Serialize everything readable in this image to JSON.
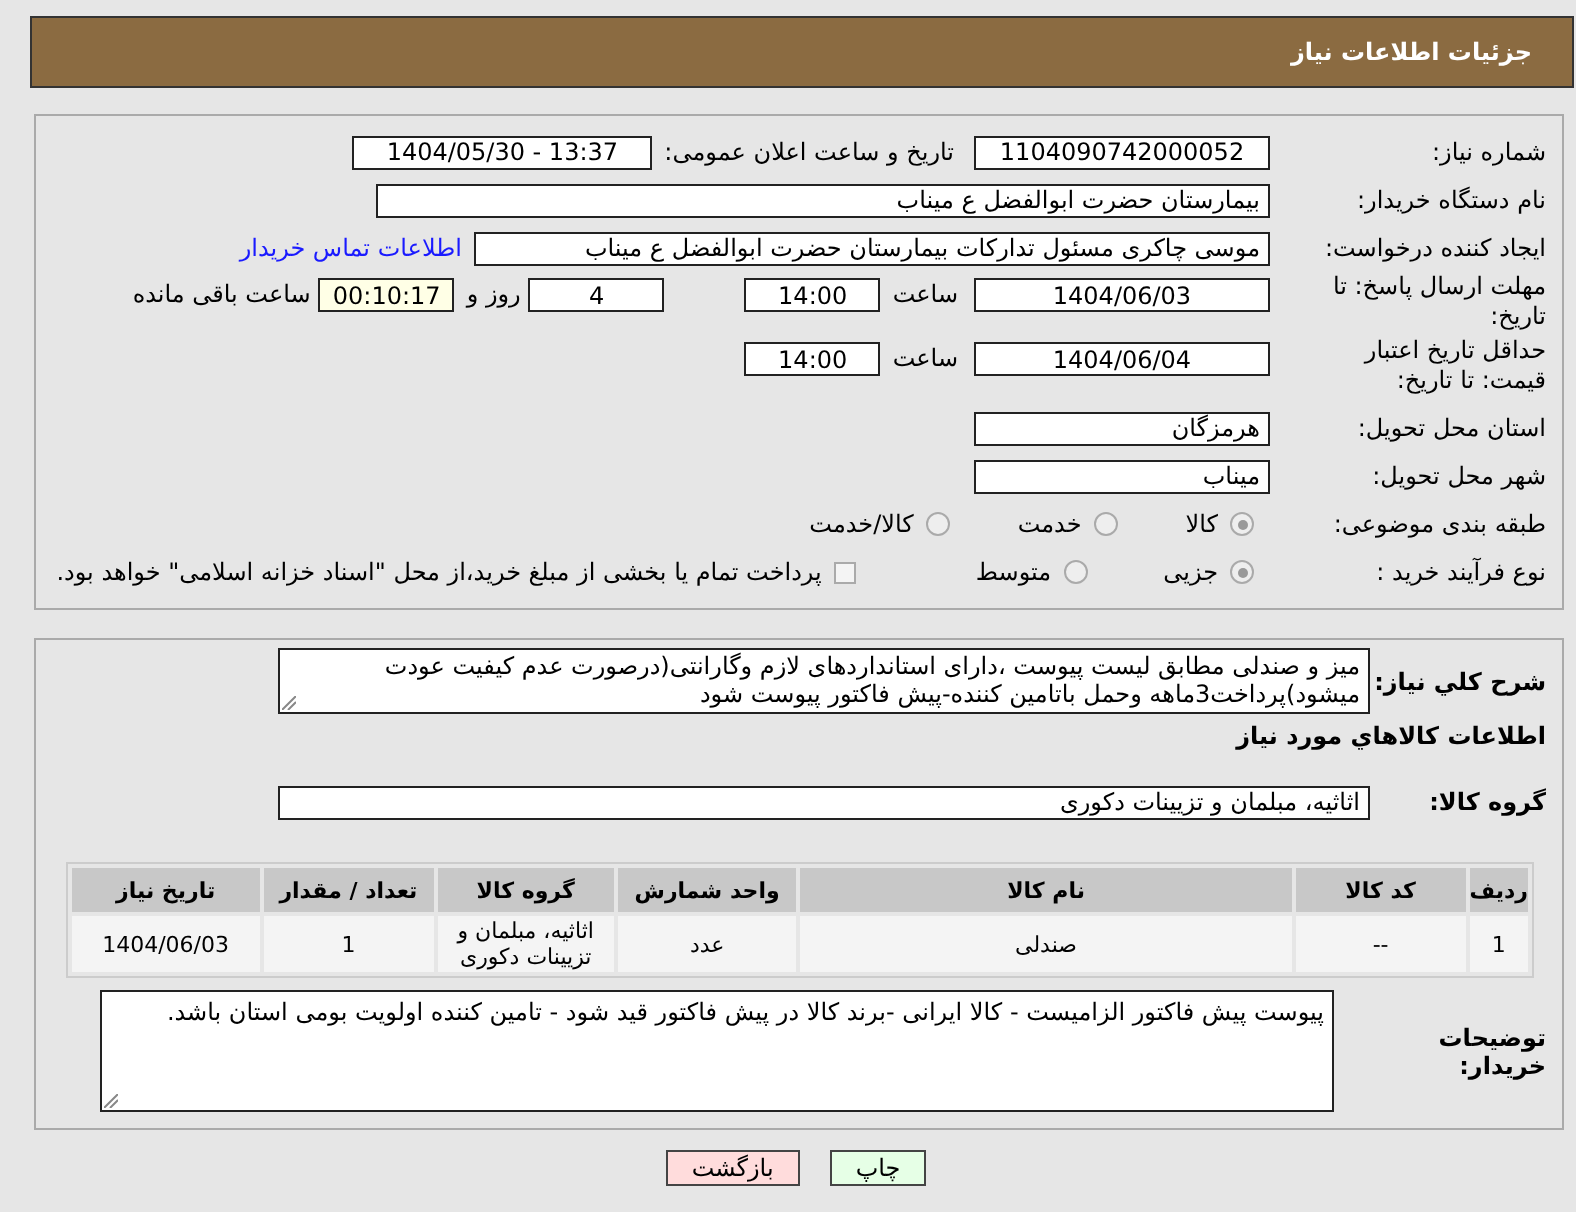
{
  "header": {
    "title": "جزئیات اطلاعات نیاز"
  },
  "details": {
    "need_number": {
      "label": "شماره نیاز:",
      "value": "1104090742000052"
    },
    "announce": {
      "label": "تاریخ و ساعت اعلان عمومی:",
      "value": "1404/05/30 - 13:37"
    },
    "buyer": {
      "label": "نام دستگاه خریدار:",
      "value": "بیمارستان حضرت ابوالفضل ع  میناب"
    },
    "requester": {
      "label": "ایجاد کننده درخواست:",
      "value": "موسی چاکری مسئول تدارکات بیمارستان حضرت ابوالفضل ع  میناب",
      "link": "اطلاعات تماس خریدار"
    },
    "deadline": {
      "label": "مهلت ارسال پاسخ: تا تاریخ:",
      "date": "1404/06/03",
      "time_label": "ساعت",
      "time": "14:00",
      "days": "4",
      "days_label": "روز و",
      "remaining": "00:10:17",
      "remaining_label": "ساعت باقی مانده"
    },
    "validity": {
      "label": "حداقل تاریخ اعتبار قیمت: تا تاریخ:",
      "date": "1404/06/04",
      "time_label": "ساعت",
      "time": "14:00"
    },
    "province": {
      "label": "استان محل تحویل:",
      "value": "هرمزگان"
    },
    "city": {
      "label": "شهر محل تحویل:",
      "value": "میناب"
    },
    "category": {
      "label": "طبقه بندی موضوعی:",
      "options": [
        {
          "label": "کالا",
          "selected": true
        },
        {
          "label": "خدمت",
          "selected": false
        },
        {
          "label": "کالا/خدمت",
          "selected": false
        }
      ]
    },
    "process": {
      "label": "نوع فرآیند خرید :",
      "options": [
        {
          "label": "جزیی",
          "selected": true
        },
        {
          "label": "متوسط",
          "selected": false
        }
      ],
      "payment": {
        "label": "پرداخت تمام یا بخشی از مبلغ خرید،از محل \"اسناد خزانه اسلامی\" خواهد بود.",
        "checked": false
      }
    }
  },
  "needs": {
    "description": {
      "label": "شرح کلي نياز:",
      "value": "میز و صندلی مطابق لیست پیوست ،دارای استانداردهای لازم وگارانتی(درصورت عدم کیفیت عودت میشود)پرداخت3ماهه وحمل باتامین کننده-پیش فاکتور پیوست شود"
    },
    "goods_heading": "اطلاعات کالاهاي مورد نياز",
    "group": {
      "label": "گروه کالا:",
      "value": "اثاثیه، مبلمان و تزیینات دکوری"
    },
    "table": {
      "columns": [
        "ردیف",
        "کد کالا",
        "نام کالا",
        "واحد شمارش",
        "گروه کالا",
        "تعداد / مقدار",
        "تاریخ نیاز"
      ],
      "rows": [
        [
          "1",
          "--",
          "صندلی",
          "عدد",
          "اثاثیه، مبلمان و تزیینات دکوری",
          "1",
          "1404/06/03"
        ]
      ]
    },
    "notes": {
      "label": "توضیحات خریدار:",
      "value": "پیوست پیش فاکتور الزامیست - کالا ایرانی -برند کالا در پیش فاکتور قید شود - تامین کننده اولویت بومی استان باشد."
    }
  },
  "buttons": [
    {
      "label": "چاپ",
      "kind": "print"
    },
    {
      "label": "بازگشت",
      "kind": "back"
    }
  ]
}
